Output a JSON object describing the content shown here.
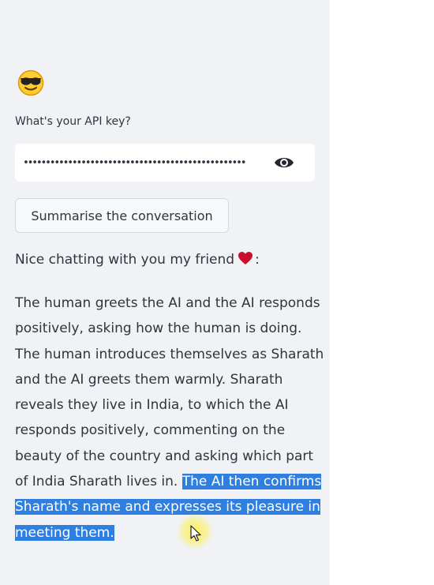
{
  "sidebar": {
    "avatar_icon": "sunglasses-emoji-icon",
    "api_label": "What's your API key?",
    "api_value": "••••••••••••••••••••••••••••••••••••••••••••••••••",
    "toggle_icon": "eye-icon",
    "summarise_label": "Summarise the conversation",
    "chat_intro": "Nice chatting with you my friend",
    "chat_suffix": ":",
    "heart_icon": "heart-icon",
    "summary_lines": [
      "The human greets the AI and the AI responds",
      "positively, asking how the human is doing.",
      "The human introduces themselves as Sharath",
      "and the AI greets them warmly. Sharath",
      "reveals they live in India, to which the AI",
      "responds positively, commenting on the",
      "beauty of the country and asking which part"
    ],
    "summary_line8_plain": "of India Sharath lives in. ",
    "summary_line8_selected": "The AI then confirms",
    "summary_line9_selected": "Sharath's name and expresses its pleasure in",
    "summary_line10_selected": "meeting them."
  },
  "colors": {
    "sidebar_bg": "#f0f2f6",
    "selection": "#2f7fe0",
    "text": "#31333f",
    "heart": "#c8102e"
  }
}
